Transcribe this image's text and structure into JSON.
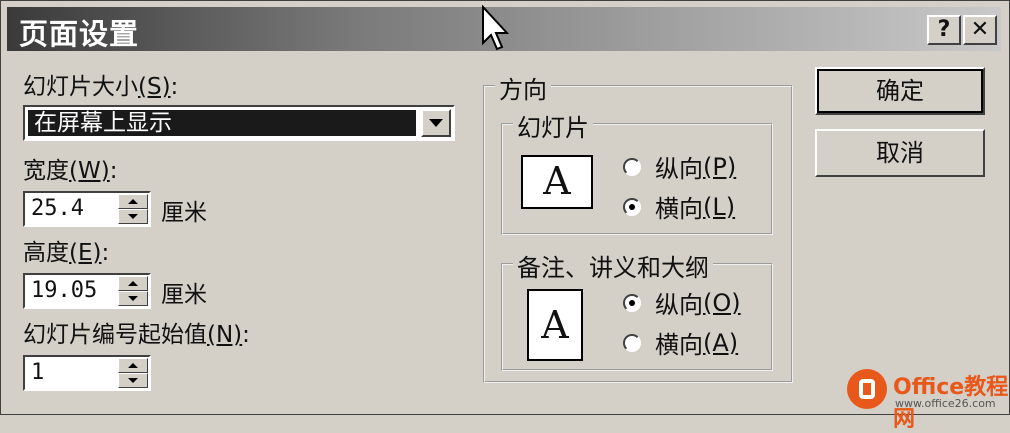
{
  "window": {
    "title": "页面设置",
    "help_label": "?",
    "close_label": "✕"
  },
  "slide_size": {
    "label_prefix": "幻灯片大小",
    "label_key": "(S)",
    "label_suffix": ":",
    "selected": "在屏幕上显示"
  },
  "width": {
    "label_prefix": "宽度",
    "label_key": "(W)",
    "label_suffix": ":",
    "value": "25.4",
    "unit": "厘米"
  },
  "height": {
    "label_prefix": "高度",
    "label_key": "(E)",
    "label_suffix": ":",
    "value": "19.05",
    "unit": "厘米"
  },
  "numbering": {
    "label_prefix": "幻灯片编号起始值",
    "label_key": "(N)",
    "label_suffix": ":",
    "value": "1"
  },
  "orientation": {
    "title": "方向",
    "slides": {
      "title": "幻灯片",
      "icon_letter": "A",
      "portrait_label": "纵向",
      "portrait_key": "(P)",
      "landscape_label": "横向",
      "landscape_key": "(L)",
      "selected": "landscape"
    },
    "notes": {
      "title": "备注、讲义和大纲",
      "icon_letter": "A",
      "portrait_label": "纵向",
      "portrait_key": "(O)",
      "landscape_label": "横向",
      "landscape_key": "(A)",
      "selected": "portrait"
    }
  },
  "buttons": {
    "ok": "确定",
    "cancel": "取消"
  },
  "watermark": {
    "text": "Office教程网",
    "url": "www.office26.com"
  }
}
